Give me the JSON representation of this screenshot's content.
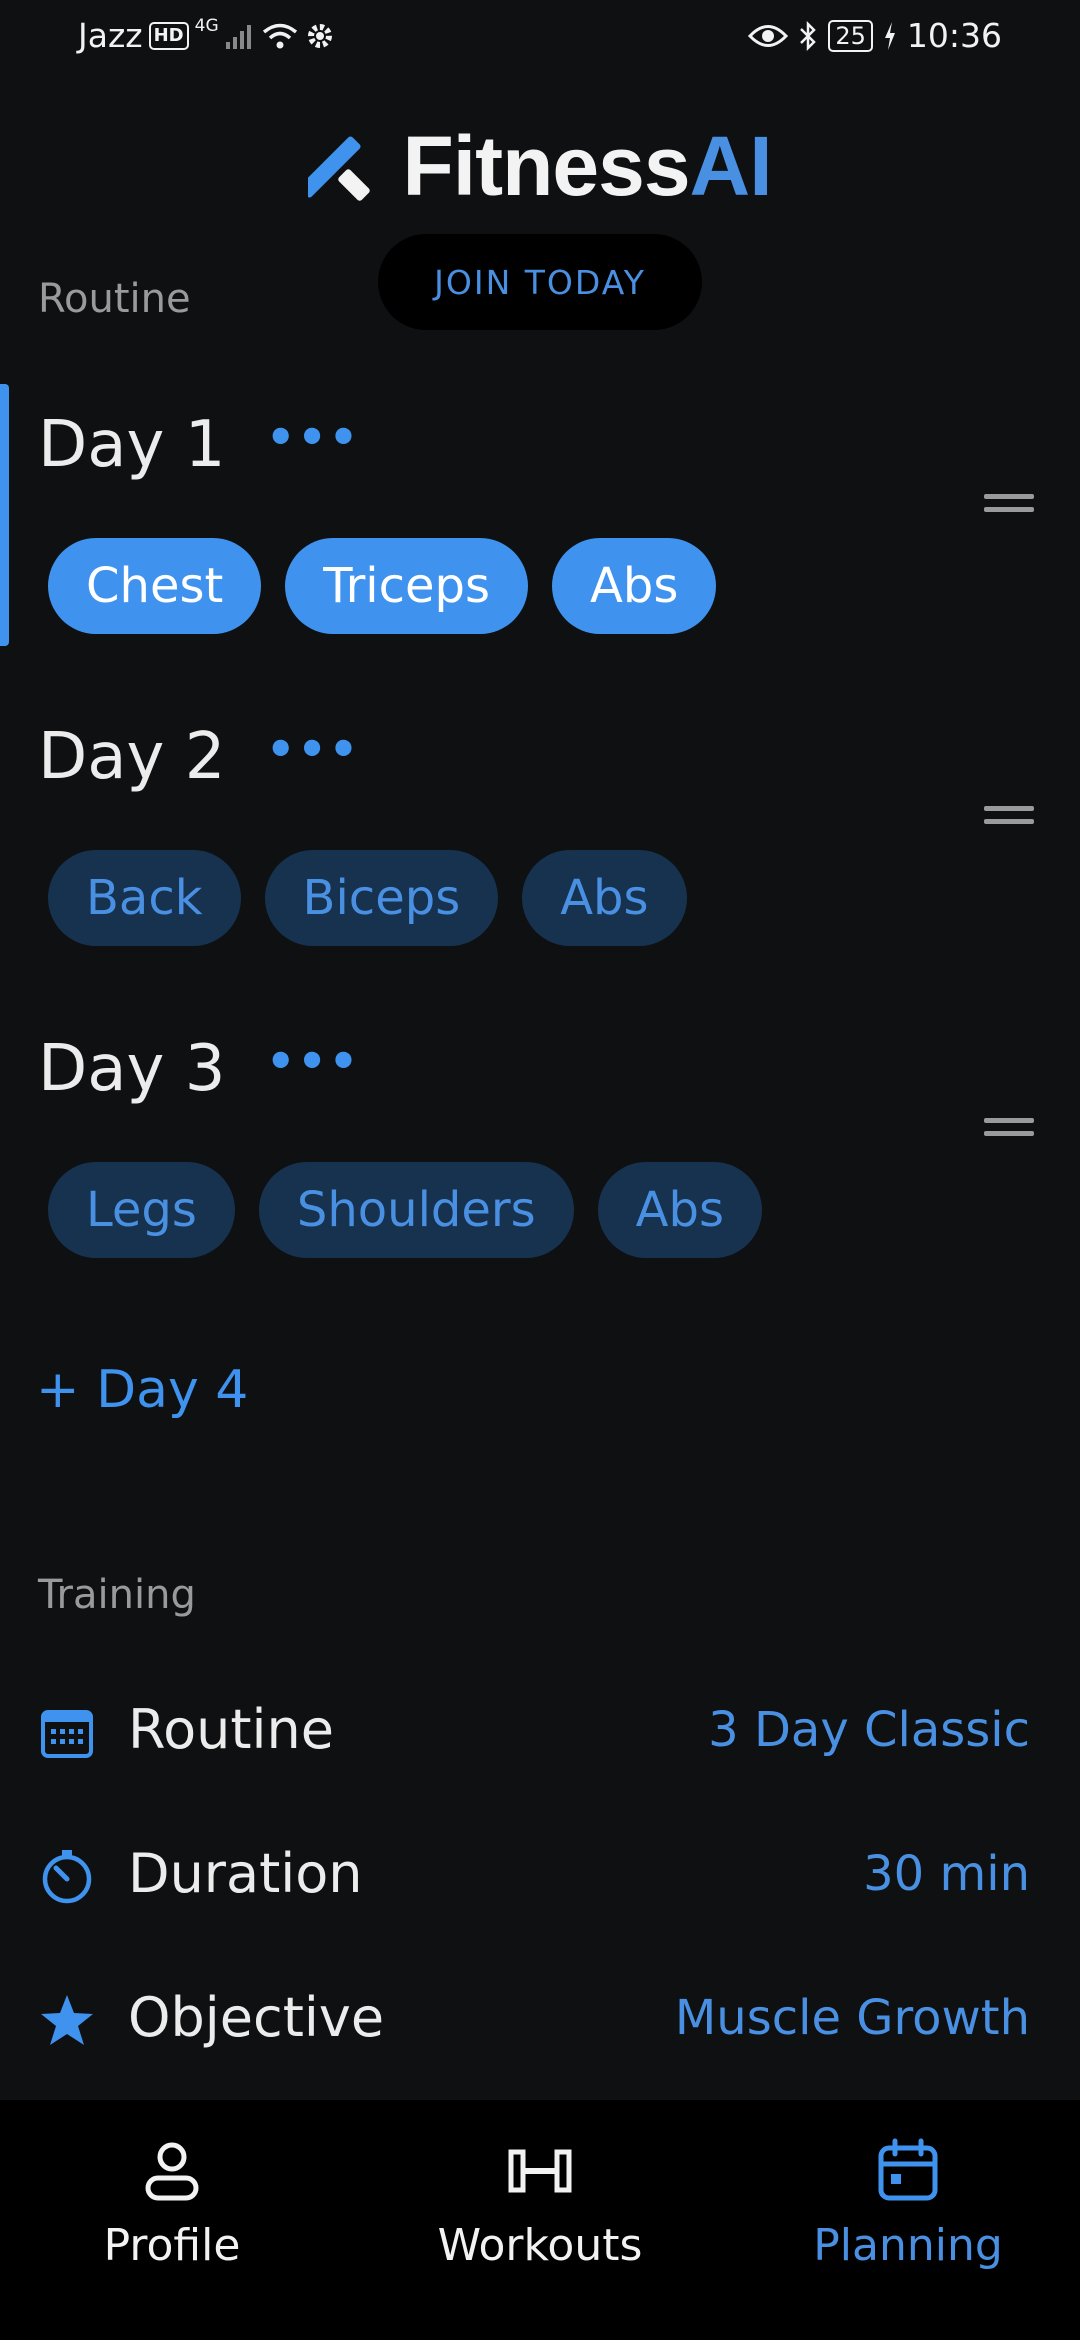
{
  "status": {
    "carrier": "Jazz",
    "hd": "HD",
    "network": "4G",
    "battery": "25",
    "time": "10:36"
  },
  "header": {
    "logo_main": "Fitness",
    "logo_ai": "AI",
    "join_label": "JOIN TODAY"
  },
  "routine": {
    "section_label": "Routine",
    "days": [
      {
        "title": "Day 1",
        "menu": "•••",
        "selected": true,
        "chips": [
          "Chest",
          "Triceps",
          "Abs"
        ]
      },
      {
        "title": "Day 2",
        "menu": "•••",
        "selected": false,
        "chips": [
          "Back",
          "Biceps",
          "Abs"
        ]
      },
      {
        "title": "Day 3",
        "menu": "•••",
        "selected": false,
        "chips": [
          "Legs",
          "Shoulders",
          "Abs"
        ]
      }
    ],
    "add_day_label": "+ Day 4"
  },
  "training": {
    "section_label": "Training",
    "rows": [
      {
        "icon": "calendar-icon",
        "label": "Routine",
        "value": "3 Day Classic"
      },
      {
        "icon": "timer-icon",
        "label": "Duration",
        "value": "30 min"
      },
      {
        "icon": "star-icon",
        "label": "Objective",
        "value": "Muscle Growth"
      }
    ]
  },
  "nav": {
    "items": [
      {
        "icon": "profile-icon",
        "label": "Profile",
        "active": false
      },
      {
        "icon": "dumbbell-icon",
        "label": "Workouts",
        "active": false
      },
      {
        "icon": "calendar-icon",
        "label": "Planning",
        "active": true
      }
    ]
  },
  "colors": {
    "accent": "#3f93ee",
    "accent_text": "#4a90e2",
    "chip_inactive_bg": "#17324f",
    "background": "#0e1012"
  }
}
